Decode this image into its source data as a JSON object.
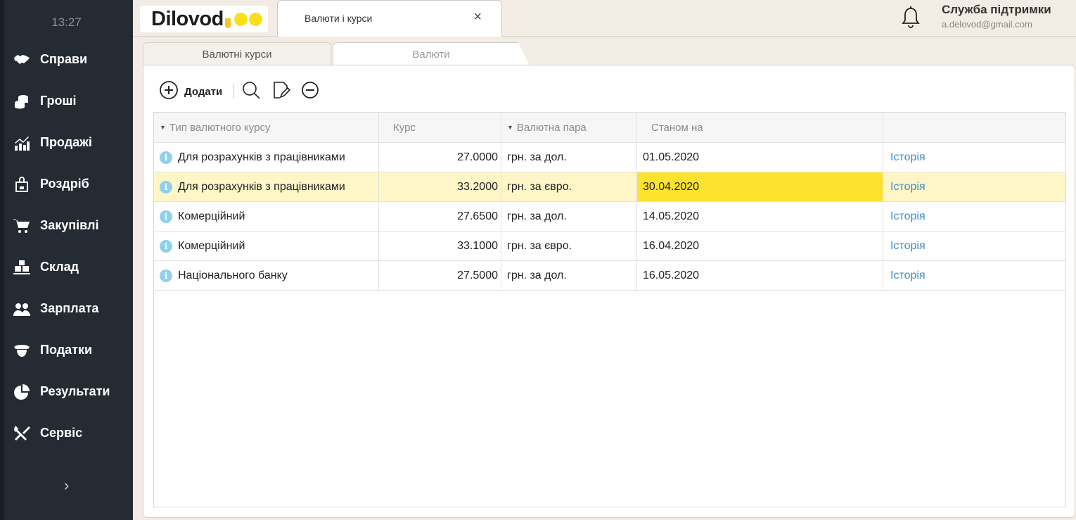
{
  "sidebar": {
    "time": "13:27",
    "items": [
      {
        "label": "Справи",
        "icon": "handshake-icon"
      },
      {
        "label": "Гроші",
        "icon": "coins-icon"
      },
      {
        "label": "Продажі",
        "icon": "sales-chart-icon"
      },
      {
        "label": "Роздріб",
        "icon": "shopping-bag-icon"
      },
      {
        "label": "Закупівлі",
        "icon": "cart-icon"
      },
      {
        "label": "Склад",
        "icon": "boxes-icon"
      },
      {
        "label": "Зарплата",
        "icon": "people-icon"
      },
      {
        "label": "Податки",
        "icon": "officer-icon"
      },
      {
        "label": "Результати",
        "icon": "pie-chart-icon"
      },
      {
        "label": "Сервіс",
        "icon": "tools-icon"
      }
    ],
    "expand_glyph": "›"
  },
  "header": {
    "logo": "Dilovod",
    "doc_tab": "Валюти і курси",
    "close_glyph": "×",
    "support_title": "Служба підтримки",
    "support_email": "a.delovod@gmail.com"
  },
  "tabs": {
    "active": "Валютні курси",
    "inactive": "Валюти"
  },
  "toolbar": {
    "add_label": "Додати"
  },
  "table": {
    "columns": [
      "Тип валютного курсу",
      "Курс",
      "Валютна пара",
      "Станом на",
      ""
    ],
    "rows": [
      {
        "type": "Для розрахунків з працівниками",
        "rate": "27.0000",
        "pair": "грн. за дол.",
        "date": "01.05.2020",
        "action": "Історія",
        "selected": false
      },
      {
        "type": "Для розрахунків з працівниками",
        "rate": "33.2000",
        "pair": "грн. за євро.",
        "date": "30.04.2020",
        "action": "Історія",
        "selected": true
      },
      {
        "type": "Комерційний",
        "rate": "27.6500",
        "pair": "грн. за дол.",
        "date": "14.05.2020",
        "action": "Історія",
        "selected": false
      },
      {
        "type": "Комерційний",
        "rate": "33.1000",
        "pair": "грн. за євро.",
        "date": "16.04.2020",
        "action": "Історія",
        "selected": false
      },
      {
        "type": "Національного банку",
        "rate": "27.5000",
        "pair": "грн. за дол.",
        "date": "16.05.2020",
        "action": "Історія",
        "selected": false
      }
    ]
  },
  "colors": {
    "sidebar_bg": "#252b33",
    "selected_row": "#fff6c8",
    "selected_cell": "#fde22e",
    "link": "#3a8ec8",
    "logo_accent": "#f7df1e"
  }
}
